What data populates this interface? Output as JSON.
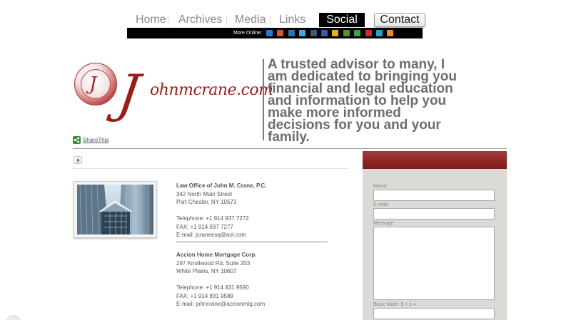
{
  "nav": {
    "items": [
      {
        "label": "Home"
      },
      {
        "label": "Archives"
      },
      {
        "label": "Media"
      },
      {
        "label": "Links"
      },
      {
        "label": "Social"
      },
      {
        "label": "Contact"
      }
    ]
  },
  "more_online": {
    "label": "More Online:",
    "icons": [
      {
        "name": "delicious-icon",
        "color": "#3274d1"
      },
      {
        "name": "blogger-icon",
        "color": "#d9523a"
      },
      {
        "name": "linkedin-icon",
        "color": "#2d72b2"
      },
      {
        "name": "twitter-icon",
        "color": "#3ea9dd"
      },
      {
        "name": "tumblr-icon",
        "color": "#3b5a7a"
      },
      {
        "name": "flickr-icon",
        "color": "#4457a8"
      },
      {
        "name": "myspace-icon",
        "color": "#e1b21c"
      },
      {
        "name": "digg-icon",
        "color": "#5a8f2e"
      },
      {
        "name": "add-icon",
        "color": "#3aa53a"
      },
      {
        "name": "youtube-icon",
        "color": "#cc2b2b"
      },
      {
        "name": "vimeo-icon",
        "color": "#2a9fcf"
      },
      {
        "name": "rss-icon",
        "color": "#f08a1c"
      }
    ]
  },
  "logo": {
    "monogram": "J",
    "big_letter": "J",
    "text": "ohnmcrane.com"
  },
  "tagline": "A trusted advisor to many, I am dedicated to bringing you financial and legal education and information to help you make more informed decisions for you and your family.",
  "share": {
    "label": "ShareThis"
  },
  "offices": [
    {
      "name": "Law Office of John M. Crane, P.C.",
      "street": "342 North Main Street",
      "city": "Port Chester, NY 10573",
      "phone": "Telephone: +1 914 937 7272",
      "fax": "FAX: +1 914 937 7277",
      "email": "E-mail: jcraneesq@aol.com"
    },
    {
      "name": "Accion Home Mortgage Corp.",
      "street": "297 Knollwood Rd, Suite 203",
      "city": "White Plains, NY 10607",
      "phone": "Telephone: +1 914 831 9590",
      "fax": "FAX: +1 914 831 9589",
      "email": "E-mail: johncrane@accionmtg.com"
    }
  ],
  "form": {
    "name_label": "Name:",
    "email_label": "E-mail:",
    "message_label": "Message:",
    "math_label": "Basic Math: 5 + 1 ="
  },
  "colors": {
    "brand_red": "#9b1c1c",
    "panel_bg": "#dcdad7",
    "nav_active_bg": "#000000"
  }
}
